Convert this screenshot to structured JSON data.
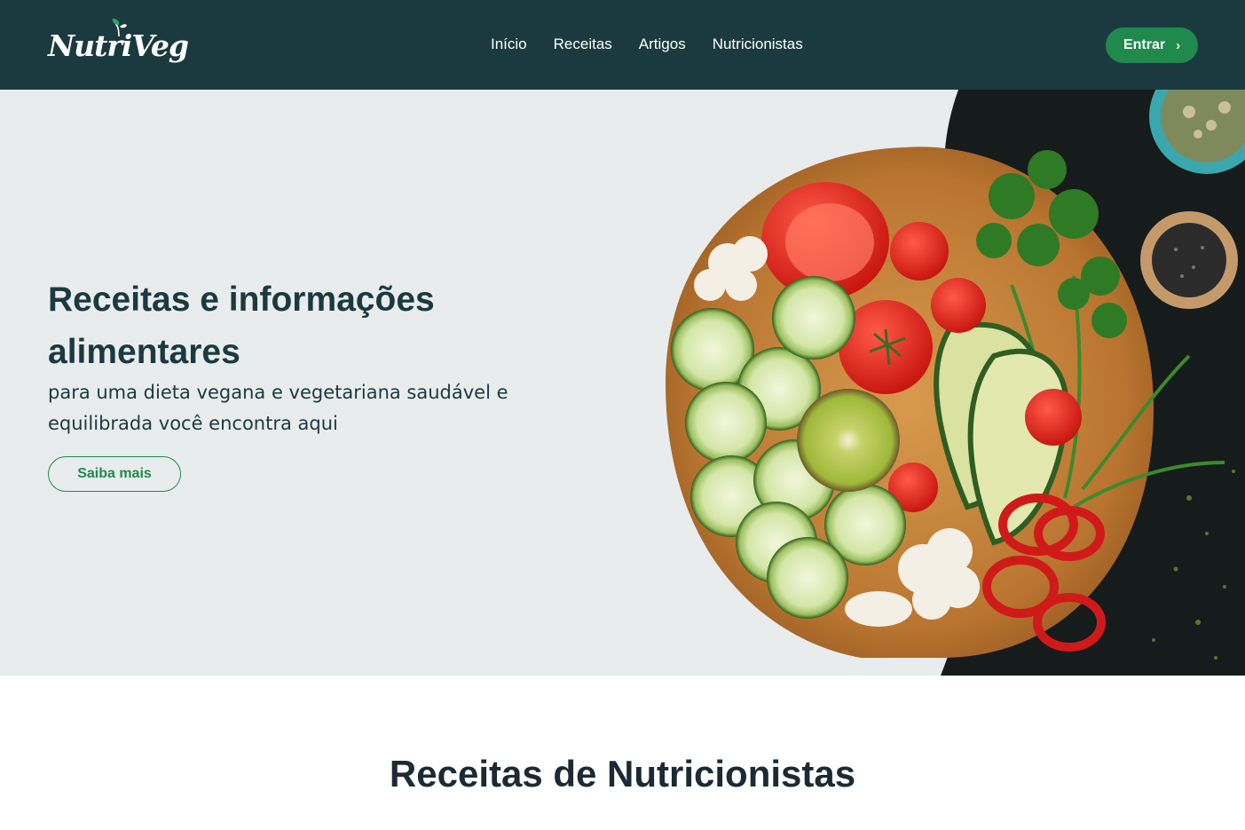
{
  "header": {
    "logo_text": "NutriVeg",
    "nav": [
      {
        "label": "Início"
      },
      {
        "label": "Receitas"
      },
      {
        "label": "Artigos"
      },
      {
        "label": "Nutricionistas"
      }
    ],
    "login_label": "Entrar",
    "login_icon": "chevron-right-icon"
  },
  "hero": {
    "title": "Receitas e informações alimentares",
    "subtitle": "para uma dieta vegana e vegetariana saudável e equilibrada você encontra aqui",
    "cta_label": "Saiba mais",
    "image": "vegetables-cutting-board-image"
  },
  "section": {
    "title": "Receitas de Nutricionistas"
  },
  "colors": {
    "header_bg": "#1b3a40",
    "accent_green": "#1f8a4c",
    "hero_bg": "#e9eced",
    "text_dark": "#1b3a40"
  }
}
